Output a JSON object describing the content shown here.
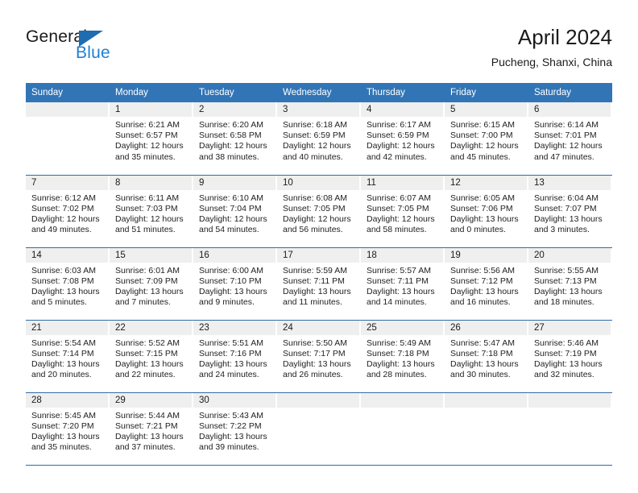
{
  "logo": {
    "word_one": "General",
    "word_two": "Blue",
    "triangle_color": "#1f6cb0",
    "blue_color": "#1f7fd4"
  },
  "header": {
    "title": "April 2024",
    "subtitle": "Pucheng, Shanxi, China"
  },
  "theme": {
    "header_blue": "#3275b6",
    "separator_blue": "#2f6ca8",
    "daynum_band": "#efefef"
  },
  "calendar": {
    "weekdays": [
      "Sunday",
      "Monday",
      "Tuesday",
      "Wednesday",
      "Thursday",
      "Friday",
      "Saturday"
    ],
    "weeks": [
      [
        {
          "day": "",
          "sunrise": "",
          "sunset": "",
          "daylight1": "",
          "daylight2": "",
          "empty": true
        },
        {
          "day": "1",
          "sunrise": "Sunrise: 6:21 AM",
          "sunset": "Sunset: 6:57 PM",
          "daylight1": "Daylight: 12 hours",
          "daylight2": "and 35 minutes."
        },
        {
          "day": "2",
          "sunrise": "Sunrise: 6:20 AM",
          "sunset": "Sunset: 6:58 PM",
          "daylight1": "Daylight: 12 hours",
          "daylight2": "and 38 minutes."
        },
        {
          "day": "3",
          "sunrise": "Sunrise: 6:18 AM",
          "sunset": "Sunset: 6:59 PM",
          "daylight1": "Daylight: 12 hours",
          "daylight2": "and 40 minutes."
        },
        {
          "day": "4",
          "sunrise": "Sunrise: 6:17 AM",
          "sunset": "Sunset: 6:59 PM",
          "daylight1": "Daylight: 12 hours",
          "daylight2": "and 42 minutes."
        },
        {
          "day": "5",
          "sunrise": "Sunrise: 6:15 AM",
          "sunset": "Sunset: 7:00 PM",
          "daylight1": "Daylight: 12 hours",
          "daylight2": "and 45 minutes."
        },
        {
          "day": "6",
          "sunrise": "Sunrise: 6:14 AM",
          "sunset": "Sunset: 7:01 PM",
          "daylight1": "Daylight: 12 hours",
          "daylight2": "and 47 minutes."
        }
      ],
      [
        {
          "day": "7",
          "sunrise": "Sunrise: 6:12 AM",
          "sunset": "Sunset: 7:02 PM",
          "daylight1": "Daylight: 12 hours",
          "daylight2": "and 49 minutes."
        },
        {
          "day": "8",
          "sunrise": "Sunrise: 6:11 AM",
          "sunset": "Sunset: 7:03 PM",
          "daylight1": "Daylight: 12 hours",
          "daylight2": "and 51 minutes."
        },
        {
          "day": "9",
          "sunrise": "Sunrise: 6:10 AM",
          "sunset": "Sunset: 7:04 PM",
          "daylight1": "Daylight: 12 hours",
          "daylight2": "and 54 minutes."
        },
        {
          "day": "10",
          "sunrise": "Sunrise: 6:08 AM",
          "sunset": "Sunset: 7:05 PM",
          "daylight1": "Daylight: 12 hours",
          "daylight2": "and 56 minutes."
        },
        {
          "day": "11",
          "sunrise": "Sunrise: 6:07 AM",
          "sunset": "Sunset: 7:05 PM",
          "daylight1": "Daylight: 12 hours",
          "daylight2": "and 58 minutes."
        },
        {
          "day": "12",
          "sunrise": "Sunrise: 6:05 AM",
          "sunset": "Sunset: 7:06 PM",
          "daylight1": "Daylight: 13 hours",
          "daylight2": "and 0 minutes."
        },
        {
          "day": "13",
          "sunrise": "Sunrise: 6:04 AM",
          "sunset": "Sunset: 7:07 PM",
          "daylight1": "Daylight: 13 hours",
          "daylight2": "and 3 minutes."
        }
      ],
      [
        {
          "day": "14",
          "sunrise": "Sunrise: 6:03 AM",
          "sunset": "Sunset: 7:08 PM",
          "daylight1": "Daylight: 13 hours",
          "daylight2": "and 5 minutes."
        },
        {
          "day": "15",
          "sunrise": "Sunrise: 6:01 AM",
          "sunset": "Sunset: 7:09 PM",
          "daylight1": "Daylight: 13 hours",
          "daylight2": "and 7 minutes."
        },
        {
          "day": "16",
          "sunrise": "Sunrise: 6:00 AM",
          "sunset": "Sunset: 7:10 PM",
          "daylight1": "Daylight: 13 hours",
          "daylight2": "and 9 minutes."
        },
        {
          "day": "17",
          "sunrise": "Sunrise: 5:59 AM",
          "sunset": "Sunset: 7:11 PM",
          "daylight1": "Daylight: 13 hours",
          "daylight2": "and 11 minutes."
        },
        {
          "day": "18",
          "sunrise": "Sunrise: 5:57 AM",
          "sunset": "Sunset: 7:11 PM",
          "daylight1": "Daylight: 13 hours",
          "daylight2": "and 14 minutes."
        },
        {
          "day": "19",
          "sunrise": "Sunrise: 5:56 AM",
          "sunset": "Sunset: 7:12 PM",
          "daylight1": "Daylight: 13 hours",
          "daylight2": "and 16 minutes."
        },
        {
          "day": "20",
          "sunrise": "Sunrise: 5:55 AM",
          "sunset": "Sunset: 7:13 PM",
          "daylight1": "Daylight: 13 hours",
          "daylight2": "and 18 minutes."
        }
      ],
      [
        {
          "day": "21",
          "sunrise": "Sunrise: 5:54 AM",
          "sunset": "Sunset: 7:14 PM",
          "daylight1": "Daylight: 13 hours",
          "daylight2": "and 20 minutes."
        },
        {
          "day": "22",
          "sunrise": "Sunrise: 5:52 AM",
          "sunset": "Sunset: 7:15 PM",
          "daylight1": "Daylight: 13 hours",
          "daylight2": "and 22 minutes."
        },
        {
          "day": "23",
          "sunrise": "Sunrise: 5:51 AM",
          "sunset": "Sunset: 7:16 PM",
          "daylight1": "Daylight: 13 hours",
          "daylight2": "and 24 minutes."
        },
        {
          "day": "24",
          "sunrise": "Sunrise: 5:50 AM",
          "sunset": "Sunset: 7:17 PM",
          "daylight1": "Daylight: 13 hours",
          "daylight2": "and 26 minutes."
        },
        {
          "day": "25",
          "sunrise": "Sunrise: 5:49 AM",
          "sunset": "Sunset: 7:18 PM",
          "daylight1": "Daylight: 13 hours",
          "daylight2": "and 28 minutes."
        },
        {
          "day": "26",
          "sunrise": "Sunrise: 5:47 AM",
          "sunset": "Sunset: 7:18 PM",
          "daylight1": "Daylight: 13 hours",
          "daylight2": "and 30 minutes."
        },
        {
          "day": "27",
          "sunrise": "Sunrise: 5:46 AM",
          "sunset": "Sunset: 7:19 PM",
          "daylight1": "Daylight: 13 hours",
          "daylight2": "and 32 minutes."
        }
      ],
      [
        {
          "day": "28",
          "sunrise": "Sunrise: 5:45 AM",
          "sunset": "Sunset: 7:20 PM",
          "daylight1": "Daylight: 13 hours",
          "daylight2": "and 35 minutes."
        },
        {
          "day": "29",
          "sunrise": "Sunrise: 5:44 AM",
          "sunset": "Sunset: 7:21 PM",
          "daylight1": "Daylight: 13 hours",
          "daylight2": "and 37 minutes."
        },
        {
          "day": "30",
          "sunrise": "Sunrise: 5:43 AM",
          "sunset": "Sunset: 7:22 PM",
          "daylight1": "Daylight: 13 hours",
          "daylight2": "and 39 minutes."
        },
        {
          "day": "",
          "sunrise": "",
          "sunset": "",
          "daylight1": "",
          "daylight2": "",
          "empty": true
        },
        {
          "day": "",
          "sunrise": "",
          "sunset": "",
          "daylight1": "",
          "daylight2": "",
          "empty": true
        },
        {
          "day": "",
          "sunrise": "",
          "sunset": "",
          "daylight1": "",
          "daylight2": "",
          "empty": true
        },
        {
          "day": "",
          "sunrise": "",
          "sunset": "",
          "daylight1": "",
          "daylight2": "",
          "empty": true
        }
      ]
    ]
  }
}
